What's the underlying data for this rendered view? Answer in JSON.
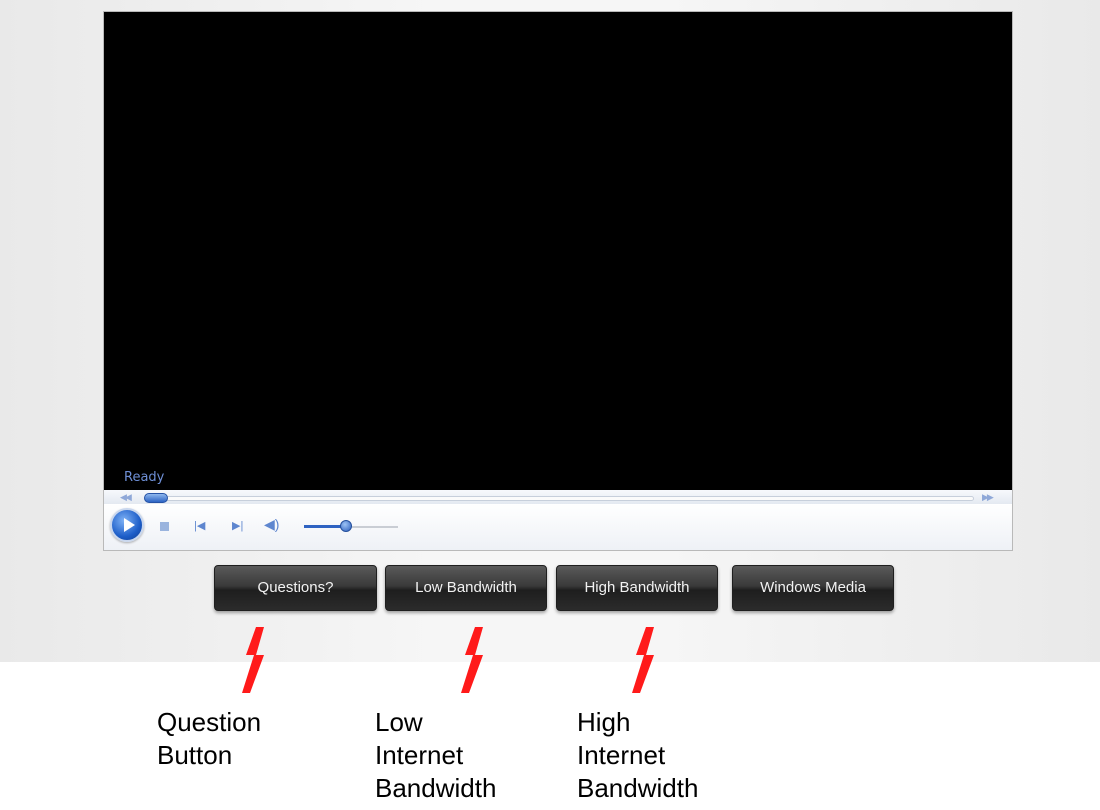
{
  "player": {
    "status": "Ready",
    "seek_progress": 0.0,
    "volume": 0.45,
    "controls": {
      "play": "play-icon",
      "stop": "stop-icon",
      "previous": "previous-icon",
      "next": "next-icon",
      "volume": "speaker-icon",
      "rewind": "rewind-icon",
      "fast_forward": "fast-forward-icon"
    }
  },
  "buttons": {
    "questions": "Questions?",
    "low_bandwidth": "Low Bandwidth",
    "high_bandwidth": "High Bandwidth",
    "windows_media": "Windows Media"
  },
  "annotations": {
    "question": "Question\nButton",
    "low": "Low\nInternet\nBandwidth",
    "high": "High\nInternet\nBandwidth"
  },
  "colors": {
    "arrow": "#ff1a1a",
    "status_text": "#6e8fd6",
    "button_bg": "#2b2b2b",
    "video_bg": "#000000"
  }
}
